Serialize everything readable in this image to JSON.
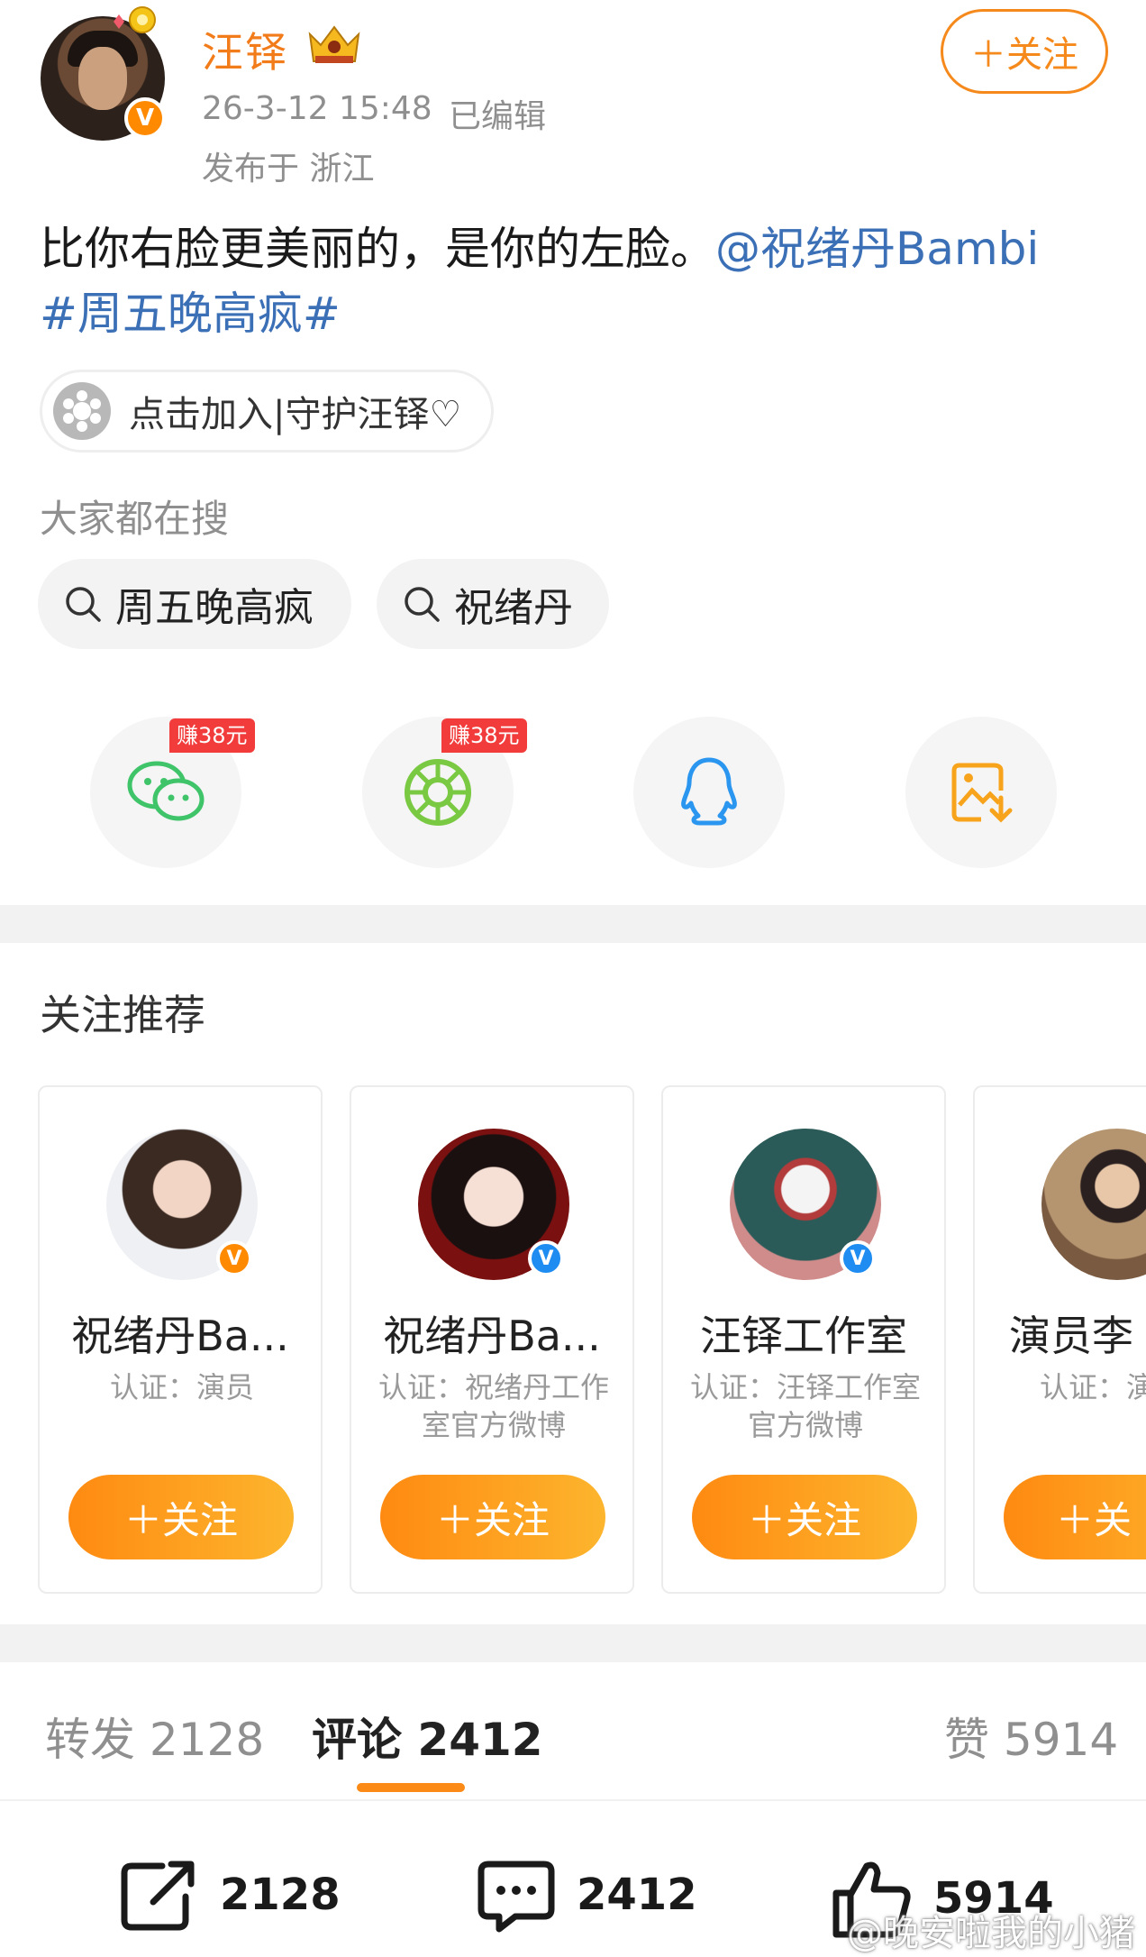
{
  "header": {
    "user_name": "汪铎",
    "time": "26-3-12 15:48",
    "edited": "已编辑",
    "location": "发布于 浙江",
    "follow_label": "＋关注"
  },
  "post": {
    "text": "比你右脸更美丽的，是你的左脸。",
    "mention": "@祝绪丹Bambi",
    "hashtag": "#周五晚高疯#"
  },
  "fan_group": {
    "label": "点击加入|守护汪铎♡",
    "icon": "flower-icon"
  },
  "search": {
    "title": "大家都在搜",
    "chips": [
      "周五晚高疯",
      "祝绪丹"
    ]
  },
  "share": {
    "items": [
      {
        "icon": "wechat-icon",
        "tag": "赚38元"
      },
      {
        "icon": "moments-icon",
        "tag": "赚38元"
      },
      {
        "icon": "qq-icon",
        "tag": ""
      },
      {
        "icon": "save-image-icon",
        "tag": ""
      }
    ]
  },
  "recommend": {
    "title": "关注推荐",
    "cards": [
      {
        "name": "祝绪丹Ba...",
        "cert": "认证：演员",
        "follow": "＋关注"
      },
      {
        "name": "祝绪丹Ba...",
        "cert": "认证：祝绪丹工作室官方微博",
        "follow": "＋关注"
      },
      {
        "name": "汪铎工作室",
        "cert": "认证：汪铎工作室官方微博",
        "follow": "＋关注"
      },
      {
        "name": "演员李",
        "cert": "认证：演",
        "follow": "＋关"
      }
    ]
  },
  "tabs": {
    "repost": "转发 2128",
    "comment": "评论 2412",
    "like": "赞 5914"
  },
  "actions": {
    "repost_count": "2128",
    "comment_count": "2412",
    "like_count": "5914"
  },
  "watermark": "@晚安啦我的小猪",
  "colors": {
    "accent_orange": "#f5891c",
    "link_blue": "#3b6fb6",
    "verified_orange": "#ff8a00",
    "verified_blue": "#1e8cf0",
    "earn_red": "#f23c3c"
  }
}
